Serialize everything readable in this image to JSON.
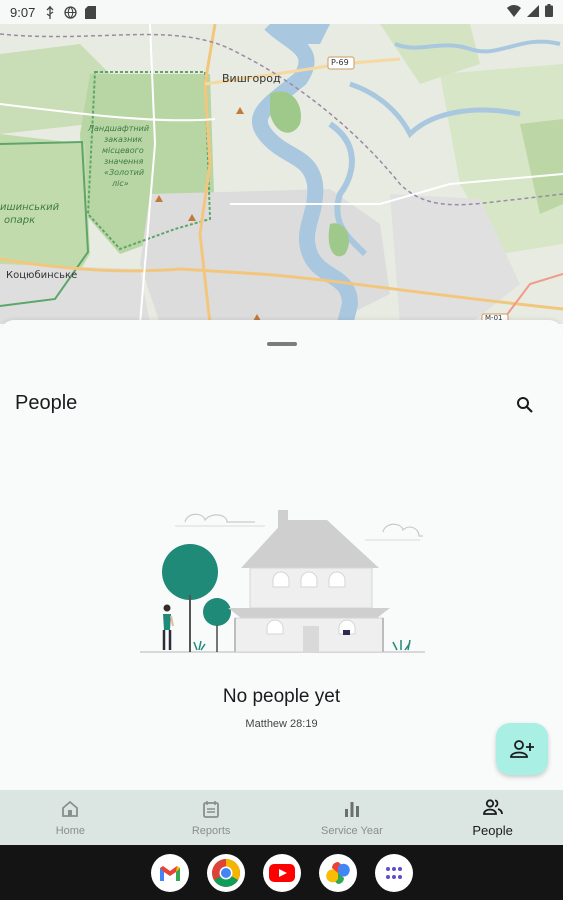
{
  "status_bar": {
    "time": "9:07",
    "left_icons": [
      "usb-icon",
      "vpn-globe-icon",
      "sd-card-icon"
    ],
    "right_icons": [
      "wifi-icon",
      "signal-icon",
      "battery-icon"
    ]
  },
  "map": {
    "labels": {
      "vyshhorod": "Вишгород",
      "road_p69": "P-69",
      "reserve_line1": "Ландшафтний",
      "reserve_line2": "заказник",
      "reserve_line3": "місцевого",
      "reserve_line4": "значення",
      "reserve_line5": "«Золотий",
      "reserve_line6": "ліс»",
      "left_line1": "ишинський",
      "left_line2": "опарк",
      "kotsiubynske": "Коцюбинське",
      "road_m01": "M-01"
    }
  },
  "sheet": {
    "title": "People",
    "empty_title": "No people yet",
    "empty_verse": "Matthew 28:19"
  },
  "nav": {
    "items": [
      {
        "label": "Home",
        "icon": "home-icon",
        "active": false
      },
      {
        "label": "Reports",
        "icon": "reports-icon",
        "active": false
      },
      {
        "label": "Service Year",
        "icon": "bar-chart-icon",
        "active": false
      },
      {
        "label": "People",
        "icon": "people-icon",
        "active": true
      }
    ]
  },
  "dock": {
    "apps": [
      "gmail-icon",
      "chrome-icon",
      "youtube-icon",
      "photos-icon",
      "app-drawer-icon"
    ]
  },
  "colors": {
    "accent_teal": "#1f8a78",
    "fab_bg": "#a9efe4",
    "nav_bg": "#dbe6e3"
  }
}
